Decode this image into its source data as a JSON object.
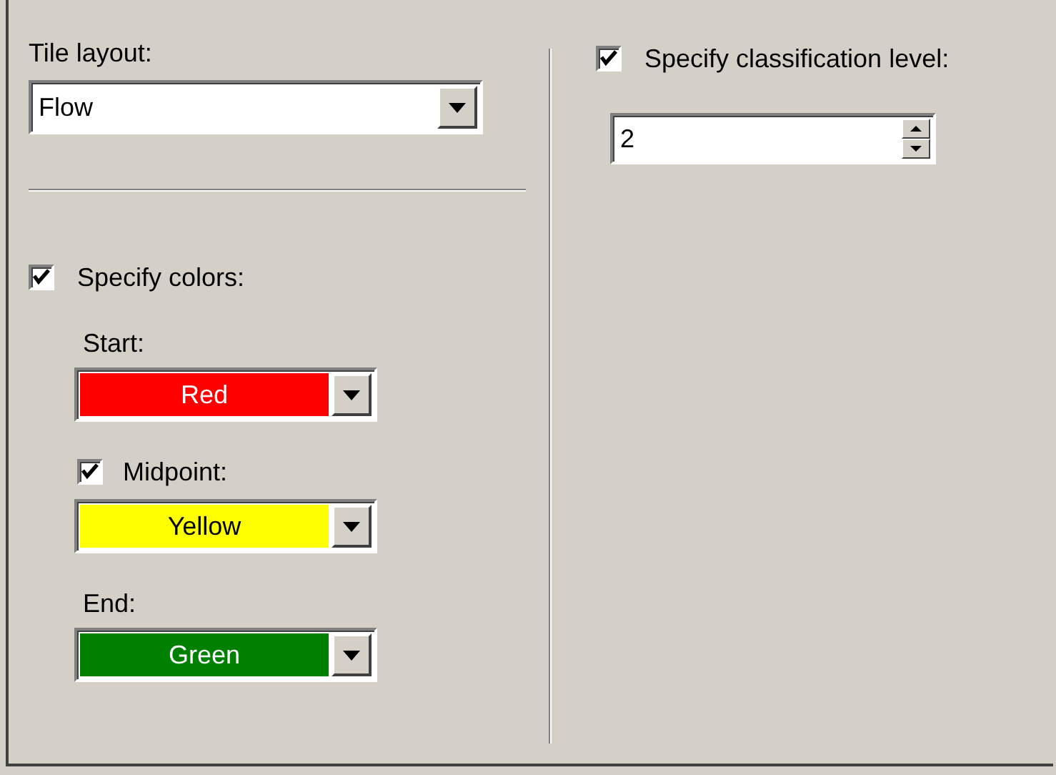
{
  "tile_layout": {
    "label": "Tile layout:",
    "value": "Flow"
  },
  "specify_colors": {
    "label": "Specify colors:",
    "checked": true
  },
  "colors": [
    {
      "kind": "label",
      "label": "Start:",
      "value": "Red",
      "color": "#ff0000"
    },
    {
      "kind": "checkbox",
      "label": "Midpoint:",
      "checked": true,
      "value": "Yellow",
      "color": "#ffff00"
    },
    {
      "kind": "label",
      "label": "End:",
      "value": "Green",
      "color": "#008000"
    }
  ],
  "classification": {
    "label": "Specify classification level:",
    "checked": true,
    "value": "2"
  }
}
